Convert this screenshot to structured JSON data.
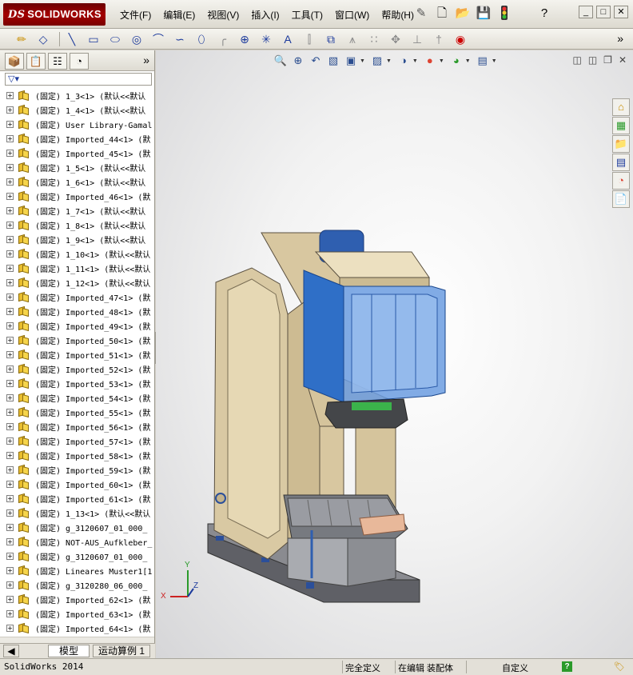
{
  "window": {
    "app_logo": "SOLIDWORKS",
    "menus": [
      "文件(F)",
      "编辑(E)",
      "视图(V)",
      "插入(I)",
      "工具(T)",
      "窗口(W)",
      "帮助(H)"
    ],
    "title_icons": [
      "pin-icon",
      "new-document-icon",
      "open-folder-icon",
      "save-icon",
      "traffic-light-icon",
      "help-icon"
    ]
  },
  "toolbar": {
    "tools": [
      "sketch-icon",
      "smart-dimension-icon",
      "line-icon",
      "rectangle-icon",
      "slot-icon",
      "circle-icon",
      "arc-icon",
      "spline-icon",
      "ellipse-icon",
      "fillet-icon",
      "point-icon",
      "centerline-icon",
      "text-icon",
      "mirror-icon",
      "offset-icon",
      "trim-icon",
      "pattern-icon",
      "move-icon",
      "display-relation-icon",
      "quick-snap-icon",
      "repair-icon"
    ]
  },
  "panel": {
    "tabs": [
      "feature-manager-icon",
      "property-manager-icon",
      "configuration-manager-icon",
      "display-manager-icon"
    ],
    "filter_icon": "filter-icon",
    "tree_items": [
      "(固定) 1_3<1> (默认<<默认",
      "(固定) 1_4<1> (默认<<默认",
      "(固定) User Library-Gamal",
      "(固定) Imported_44<1> (默",
      "(固定) Imported_45<1> (默",
      "(固定) 1_5<1> (默认<<默认",
      "(固定) 1_6<1> (默认<<默认",
      "(固定) Imported_46<1> (默",
      "(固定) 1_7<1> (默认<<默认",
      "(固定) 1_8<1> (默认<<默认",
      "(固定) 1_9<1> (默认<<默认",
      "(固定) 1_10<1> (默认<<默认",
      "(固定) 1_11<1> (默认<<默认",
      "(固定) 1_12<1> (默认<<默认",
      "(固定) Imported_47<1> (默",
      "(固定) Imported_48<1> (默",
      "(固定) Imported_49<1> (默",
      "(固定) Imported_50<1> (默",
      "(固定) Imported_51<1> (默",
      "(固定) Imported_52<1> (默",
      "(固定) Imported_53<1> (默",
      "(固定) Imported_54<1> (默",
      "(固定) Imported_55<1> (默",
      "(固定) Imported_56<1> (默",
      "(固定) Imported_57<1> (默",
      "(固定) Imported_58<1> (默",
      "(固定) Imported_59<1> (默",
      "(固定) Imported_60<1> (默",
      "(固定) Imported_61<1> (默",
      "(固定) 1_13<1> (默认<<默认",
      "(固定) g_3120607_01_000_",
      "(固定) NOT-AUS_Aufkleber_",
      "(固定) g_3120607_01_000_",
      "(固定) Lineares Muster1[1",
      "(固定) g_3120280_06_000_",
      "(固定) Imported_62<1> (默",
      "(固定) Imported_63<1> (默",
      "(固定) Imported_64<1> (默"
    ],
    "bottom_tabs": [
      "模型",
      "运动算例 1"
    ]
  },
  "viewport": {
    "headsup_tools": [
      "zoom-to-fit-icon",
      "zoom-area-icon",
      "previous-view-icon",
      "section-view-icon",
      "view-orientation-icon",
      "display-style-icon",
      "hide-show-icon",
      "appearance-icon",
      "scene-icon",
      "view-settings-icon"
    ],
    "window_controls": [
      "tile-horizontal-icon",
      "tile-vertical-icon",
      "restore-icon",
      "close-icon"
    ],
    "task_pane": [
      "home-icon",
      "design-library-icon",
      "file-explorer-icon",
      "view-palette-icon",
      "appearances-icon",
      "custom-properties-icon"
    ],
    "triad": {
      "x": "X",
      "y": "Y",
      "z": "Z"
    },
    "colors": {
      "frame": "#d9c9a3",
      "head": "#2f6fc7",
      "base": "#6e6e73"
    }
  },
  "status": {
    "app": "SolidWorks 2014",
    "definition": "完全定义",
    "mode": "在编辑 装配体",
    "units": "自定义",
    "help_icon": "?"
  }
}
